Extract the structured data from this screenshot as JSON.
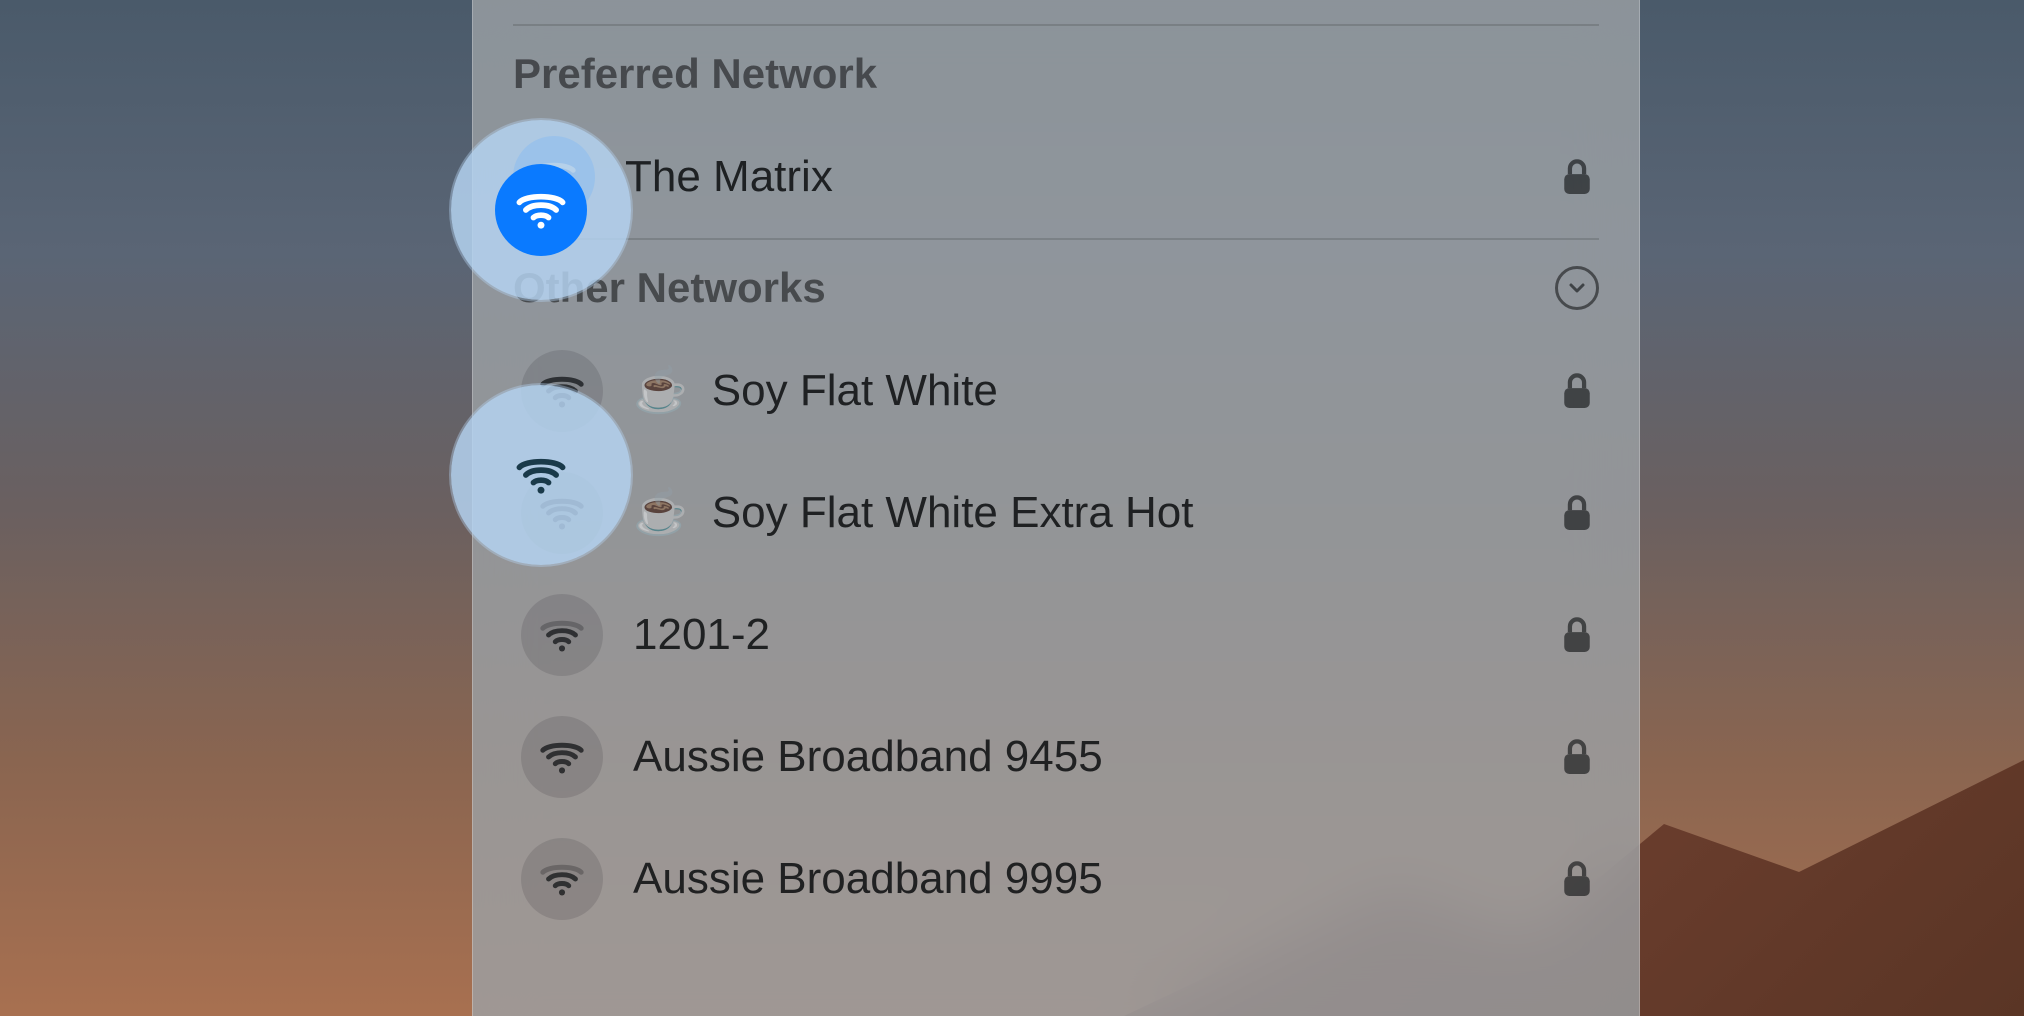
{
  "sections": {
    "preferred_label": "Preferred Network",
    "other_label": "Other Networks"
  },
  "preferred_network": {
    "name": "The Matrix",
    "connected": true,
    "secured": true
  },
  "other_networks": [
    {
      "name": "Soy Flat White",
      "emoji": "☕",
      "secured": true,
      "signal": "strong"
    },
    {
      "name": "Soy Flat White Extra Hot",
      "emoji": "☕",
      "secured": true,
      "signal": "strong"
    },
    {
      "name": "1201-2",
      "emoji": "",
      "secured": true,
      "signal": "medium"
    },
    {
      "name": "Aussie Broadband 9455",
      "emoji": "",
      "secured": true,
      "signal": "strong"
    },
    {
      "name": "Aussie Broadband 9995",
      "emoji": "",
      "secured": true,
      "signal": "medium"
    }
  ],
  "highlights": [
    {
      "target": "preferred",
      "connected": true
    },
    {
      "target": "other-0",
      "connected": false
    }
  ],
  "colors": {
    "accent": "#0a7aff"
  }
}
